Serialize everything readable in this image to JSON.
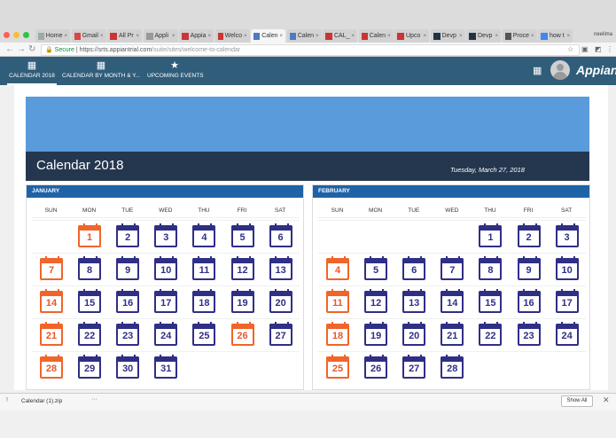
{
  "browser": {
    "tabs": [
      {
        "label": "Home",
        "color": "#9aa"
      },
      {
        "label": "Gmail",
        "color": "#d44"
      },
      {
        "label": "All Pr",
        "color": "#c33"
      },
      {
        "label": "Appli",
        "color": "#999"
      },
      {
        "label": "Appia",
        "color": "#c33"
      },
      {
        "label": "Welco",
        "color": "#c33"
      },
      {
        "label": "Calen",
        "color": "#4a7bc4",
        "active": true
      },
      {
        "label": "Calen",
        "color": "#4a7bc4"
      },
      {
        "label": "CAL_",
        "color": "#c33"
      },
      {
        "label": "Calen",
        "color": "#c33"
      },
      {
        "label": "Upco",
        "color": "#c33"
      },
      {
        "label": "Devp",
        "color": "#234"
      },
      {
        "label": "Devp",
        "color": "#234"
      },
      {
        "label": "Proce",
        "color": "#555"
      },
      {
        "label": "how t",
        "color": "#4285f4"
      }
    ],
    "user": "neelima",
    "url_secure": "Secure",
    "url_host": "https://srts.appiantrial.com",
    "url_path": "/suite/sites/welcome-to-calendar"
  },
  "app": {
    "nav": [
      {
        "label": "CALENDAR 2018",
        "icon": "calendar-icon"
      },
      {
        "label": "CALENDAR BY MONTH & Y...",
        "icon": "calendar-icon"
      },
      {
        "label": "UPCOMING EVENTS",
        "icon": "star-icon"
      }
    ],
    "brand": "Appian"
  },
  "calendar": {
    "title": "Calendar 2018",
    "today": "Tuesday, March 27, 2018",
    "weekdays": [
      "SUN",
      "MON",
      "TUE",
      "WED",
      "THU",
      "FRI",
      "SAT"
    ],
    "months": [
      {
        "name": "JANUARY",
        "start": 1,
        "days": 31,
        "highlight": [
          1,
          7,
          14,
          21,
          26,
          28
        ]
      },
      {
        "name": "FEBRUARY",
        "start": 4,
        "days": 28,
        "highlight": [
          4,
          11,
          18,
          25
        ]
      }
    ]
  },
  "downloads": {
    "file": "Calendar (1).zip",
    "more": "···",
    "show_all": "Show All",
    "close": "✕"
  },
  "colors": {
    "appbar": "#2f5d7a",
    "banner": "#5a9bdb",
    "header": "#24374f",
    "month_header": "#1e63a8",
    "day_icon": "#2f2f86",
    "highlight_icon": "#f0652a"
  }
}
